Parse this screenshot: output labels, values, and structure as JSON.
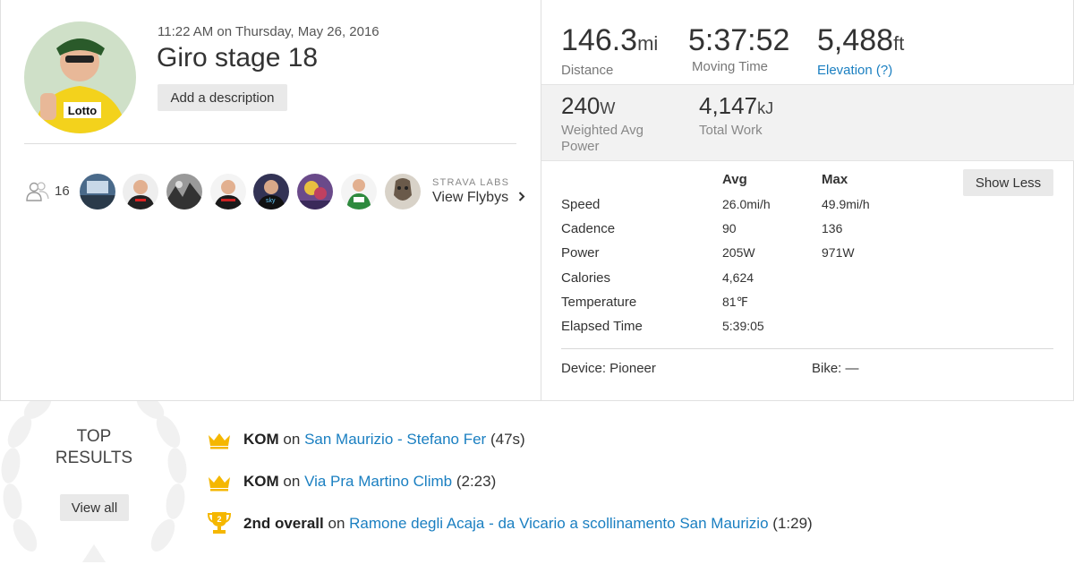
{
  "activity": {
    "datetime": "11:22 AM on Thursday, May 26, 2016",
    "title": "Giro stage 18",
    "add_description": "Add a description"
  },
  "social": {
    "group_count": "16",
    "labs_label": "STRAVA LABS",
    "flybys_label": "View Flybys",
    "athletes": [
      {
        "name": "athlete-1"
      },
      {
        "name": "athlete-2"
      },
      {
        "name": "athlete-3"
      },
      {
        "name": "athlete-4"
      },
      {
        "name": "athlete-5"
      },
      {
        "name": "athlete-6"
      },
      {
        "name": "athlete-7"
      },
      {
        "name": "athlete-8"
      }
    ]
  },
  "primary_stats": {
    "distance": {
      "value": "146.3",
      "unit": "mi",
      "label": "Distance"
    },
    "moving_time": {
      "value": "5:37:52",
      "label": "Moving Time"
    },
    "elevation": {
      "value": "5,488",
      "unit": "ft",
      "label": "Elevation (?)"
    }
  },
  "power_stats": {
    "weighted_avg_power": {
      "value": "240",
      "unit": "W",
      "label": "Weighted Avg Power"
    },
    "total_work": {
      "value": "4,147",
      "unit": "kJ",
      "label": "Total Work"
    }
  },
  "details": {
    "col_avg": "Avg",
    "col_max": "Max",
    "show_less": "Show Less",
    "rows": [
      {
        "label": "Speed",
        "avg": "26.0mi/h",
        "max": "49.9mi/h"
      },
      {
        "label": "Cadence",
        "avg": "90",
        "max": "136"
      },
      {
        "label": "Power",
        "avg": "205W",
        "max": "971W"
      },
      {
        "label": "Calories",
        "avg": "4,624",
        "max": ""
      },
      {
        "label": "Temperature",
        "avg": "81℉",
        "max": ""
      },
      {
        "label": "Elapsed Time",
        "avg": "5:39:05",
        "max": ""
      }
    ],
    "device": "Device: Pioneer",
    "bike": "Bike: —"
  },
  "top_results": {
    "heading_line1": "TOP",
    "heading_line2": "RESULTS",
    "view_all": "View all",
    "items": [
      {
        "icon": "crown-icon",
        "rank": "KOM",
        "on": "on",
        "segment": "San Maurizio - Stefano Fer",
        "time": "(47s)"
      },
      {
        "icon": "crown-icon",
        "rank": "KOM",
        "on": "on",
        "segment": "Via Pra Martino Climb",
        "time": "(2:23)"
      },
      {
        "icon": "trophy-icon",
        "trophy_number": "2",
        "rank": "2nd overall",
        "on": "on",
        "segment": "Ramone degli Acaja - da Vicario a scollinamento San Maurizio",
        "time": "(1:29)"
      }
    ]
  },
  "colors": {
    "link": "#1a7fc1",
    "crown": "#f5b700",
    "band": "#f2f2f2"
  }
}
